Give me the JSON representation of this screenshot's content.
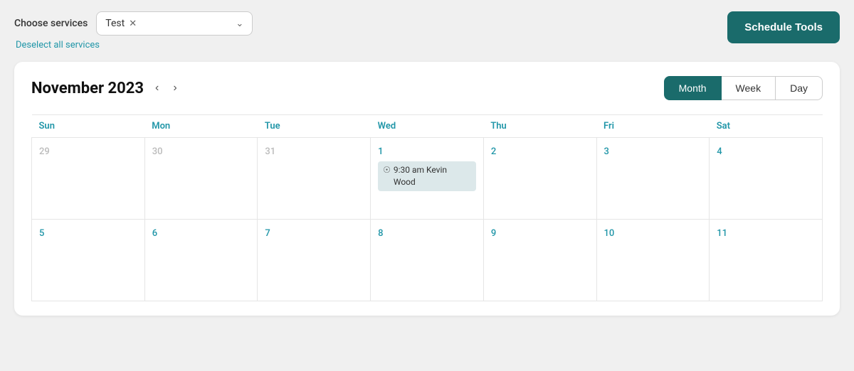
{
  "topBar": {
    "chooseServicesLabel": "Choose services",
    "serviceTag": "Test",
    "deselectLink": "Deselect all services",
    "scheduleToolsBtn": "Schedule Tools"
  },
  "calendar": {
    "title": "November 2023",
    "viewButtons": [
      {
        "label": "Month",
        "active": true
      },
      {
        "label": "Week",
        "active": false
      },
      {
        "label": "Day",
        "active": false
      }
    ],
    "weekdays": [
      "Sun",
      "Mon",
      "Tue",
      "Wed",
      "Thu",
      "Fri",
      "Sat"
    ],
    "rows": [
      {
        "days": [
          {
            "num": "29",
            "otherMonth": true,
            "event": null
          },
          {
            "num": "30",
            "otherMonth": true,
            "event": null
          },
          {
            "num": "31",
            "otherMonth": true,
            "event": null
          },
          {
            "num": "1",
            "otherMonth": false,
            "event": {
              "time": "9:30 am",
              "name": "Kevin Wood"
            }
          },
          {
            "num": "2",
            "otherMonth": false,
            "event": null
          },
          {
            "num": "3",
            "otherMonth": false,
            "event": null
          },
          {
            "num": "4",
            "otherMonth": false,
            "event": null
          }
        ]
      },
      {
        "days": [
          {
            "num": "5",
            "otherMonth": false,
            "event": null
          },
          {
            "num": "6",
            "otherMonth": false,
            "event": null
          },
          {
            "num": "7",
            "otherMonth": false,
            "event": null
          },
          {
            "num": "8",
            "otherMonth": false,
            "event": null
          },
          {
            "num": "9",
            "otherMonth": false,
            "event": null
          },
          {
            "num": "10",
            "otherMonth": false,
            "event": null
          },
          {
            "num": "11",
            "otherMonth": false,
            "event": null
          }
        ]
      }
    ]
  }
}
